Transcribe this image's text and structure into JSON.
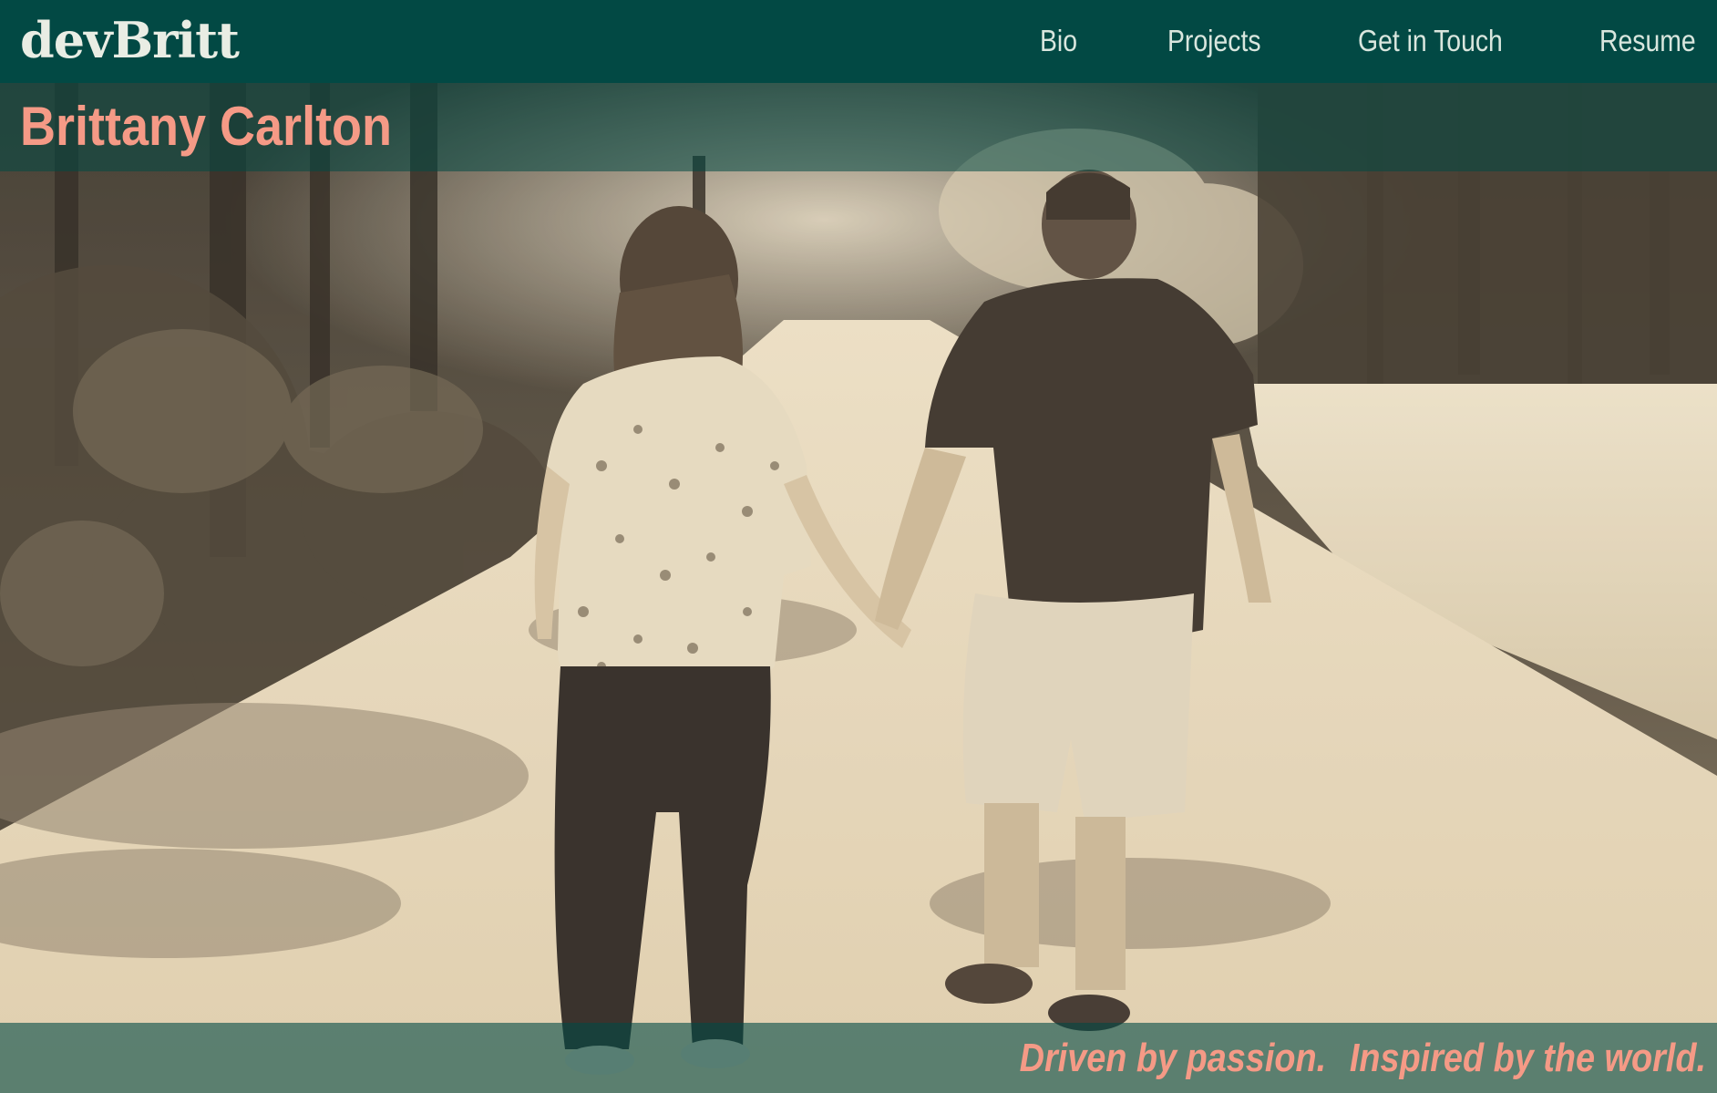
{
  "navbar": {
    "logo": "devBritt",
    "links": [
      "Bio",
      "Projects",
      "Get in Touch",
      "Resume"
    ]
  },
  "hero": {
    "name": "Brittany Carlton",
    "photo_alt": "couple walking on a wooded path",
    "tagline_part1": "Driven by passion.",
    "tagline_part2": "Inspired by the world."
  },
  "colors": {
    "nav_bg": "#024944",
    "accent_salmon": "#f59a86",
    "sepia_light": "#f1e6cf"
  }
}
